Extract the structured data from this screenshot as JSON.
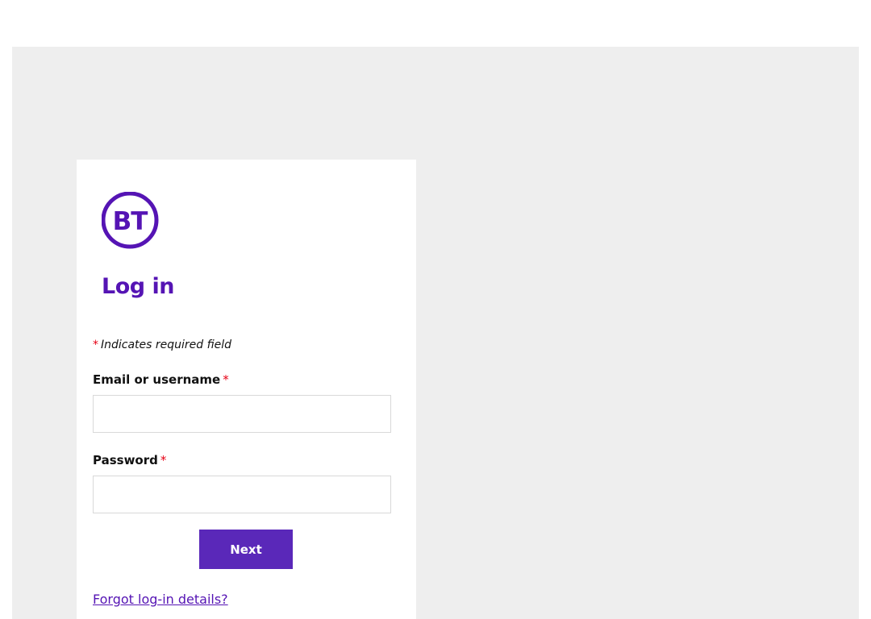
{
  "brand": {
    "logo_text": "BT",
    "color": "#5514b4"
  },
  "login": {
    "title": "Log in",
    "required_star": "*",
    "required_note": "Indicates required field",
    "email_label": "Email or username",
    "email_value": "",
    "password_label": "Password",
    "password_value": "",
    "next_label": "Next",
    "forgot_label": "Forgot log-in details?"
  },
  "colors": {
    "accent": "#5514b4",
    "button": "#5a28b9",
    "required": "#e60014",
    "page_background": "#eeeeee"
  }
}
